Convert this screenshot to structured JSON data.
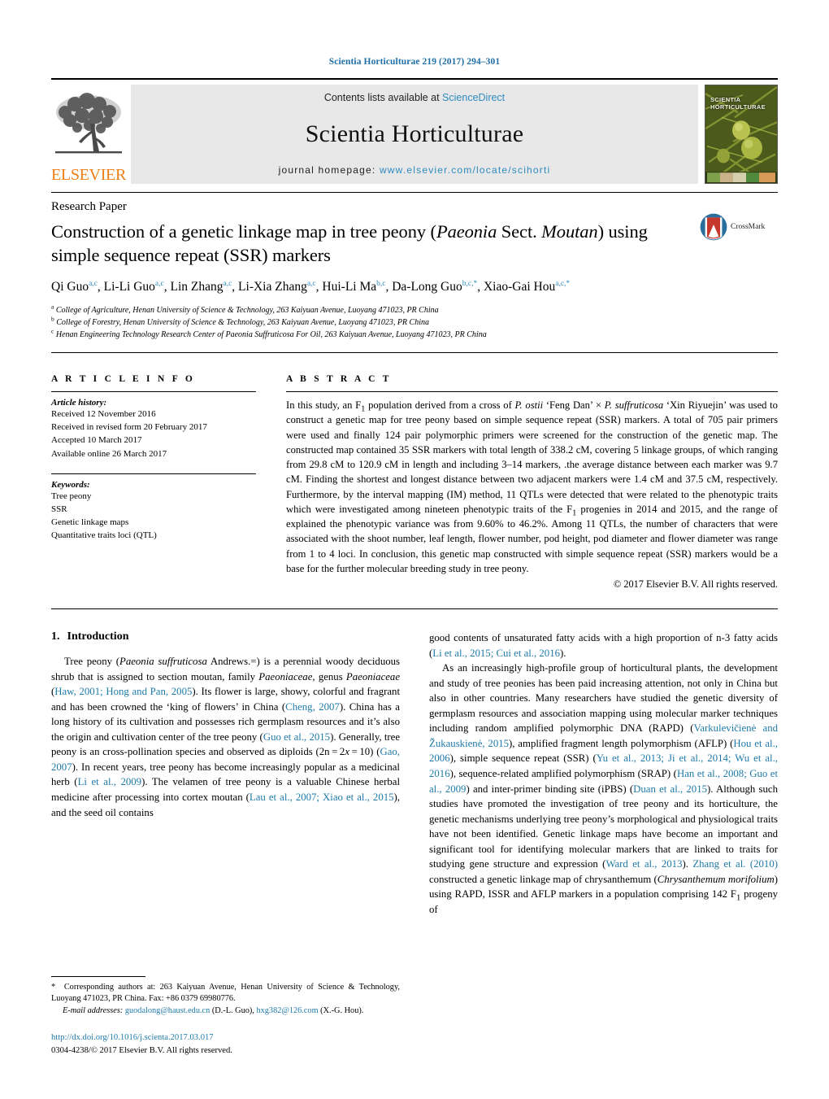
{
  "running_head": "Scientia Horticulturae 219 (2017) 294–301",
  "masthead": {
    "contents_prefix": "Contents lists available at ",
    "sciencedirect": "ScienceDirect",
    "journal_name": "Scientia Horticulturae",
    "homepage_prefix": "journal homepage: ",
    "homepage_url": "www.elsevier.com/locate/scihorti",
    "publisher_wordmark": "ELSEVIER",
    "cover_title_line1": "SCIENTIA",
    "cover_title_line2": "HORTICULTURAE",
    "link_color": "#2e8bc0",
    "elsevier_orange": "#f07f13"
  },
  "article": {
    "type": "Research Paper",
    "title_part1": "Construction of a genetic linkage map in tree peony (",
    "title_italic1": "Paeonia",
    "title_part2": " Sect. ",
    "title_italic2": "Moutan",
    "title_part3": ") using simple sequence repeat (SSR) markers",
    "authors_html": "Qi Guo<sup>a,c</sup>, Li-Li Guo<sup>a,c</sup>, Lin Zhang<sup>a,c</sup>, Li-Xia Zhang<sup>a,c</sup>, Hui-Li Ma<sup>b,c</sup>, Da-Long Guo<sup>b,c,*</sup>, Xiao-Gai Hou<sup>a,c,*</sup>",
    "crossmark_label": "CrossMark",
    "affiliations": [
      "College of Agriculture, Henan University of Science & Technology, 263 Kaiyuan Avenue, Luoyang 471023, PR China",
      "College of Forestry, Henan University of Science & Technology, 263 Kaiyuan Avenue, Luoyang 471023, PR China",
      "Henan Engineering Technology Research Center of Paeonia Suffruticosa For Oil, 263 Kaiyuan Avenue, Luoyang 471023, PR China"
    ],
    "affiliation_marks": [
      "a",
      "b",
      "c"
    ]
  },
  "article_info": {
    "heading": "A R T I C L E   I N F O",
    "history_label": "Article history:",
    "history": [
      "Received 12 November 2016",
      "Received in revised form 20 February 2017",
      "Accepted 10 March 2017",
      "Available online 26 March 2017"
    ],
    "keywords_label": "Keywords:",
    "keywords": [
      "Tree peony",
      "SSR",
      "Genetic linkage maps",
      "Quantitative traits loci (QTL)"
    ]
  },
  "abstract": {
    "heading": "A B S T R A C T",
    "body_html": "In this study, an F<sub>1</sub> population derived from a cross of <i>P. ostii</i> ‘Feng Dan’ × <i>P. suffruticosa</i> ‘Xin Riyuejin’ was used to construct a genetic map for tree peony based on simple sequence repeat (SSR) markers. A total of 705 pair primers were used and finally 124 pair polymorphic primers were screened for the construction of the genetic map. The constructed map contained 35 SSR markers with total length of 338.2 cM, covering 5 linkage groups, of which ranging from 29.8 cM to 120.9 cM in length and including 3–14 markers, .the average distance between each marker was 9.7 cM. Finding the shortest and longest distance between two adjacent markers were 1.4 cM and 37.5 cM, respectively. Furthermore, by the interval mapping (IM) method, 11 QTLs were detected that were related to the phenotypic traits which were investigated among nineteen phenotypic traits of the F<sub>1</sub> progenies in 2014 and 2015, and the range of explained the phenotypic variance was from 9.60% to 46.2%. Among 11 QTLs, the number of characters that were associated with the shoot number, leaf length, flower number, pod height, pod diameter and flower diameter was range from 1 to 4 loci. In conclusion, this genetic map constructed with simple sequence repeat (SSR) markers would be a base for the further molecular breeding study in tree peony.",
    "copyright": "© 2017 Elsevier B.V. All rights reserved."
  },
  "introduction": {
    "number": "1.",
    "heading": "Introduction",
    "left_paragraph_html": "Tree peony (<i>Paeonia suffruticosa</i> Andrews.=) is a perennial woody deciduous shrub that is assigned to section moutan, family <i>Paeoniaceae</i>, genus <i>Paeoniaceae</i> (<span class=\"ref\">Haw, 2001; Hong and Pan, 2005</span>). Its flower is large, showy, colorful and fragrant and has been crowned the ‘king of flowers’ in China (<span class=\"ref\">Cheng, 2007</span>). China has a long history of its cultivation and possesses rich germplasm resources and it’s also the origin and cultivation center of the tree peony (<span class=\"ref\">Guo et al., 2015</span>). Generally, tree peony is an cross-pollination species and observed as diploids (2n&#8201;=&#8201;2<i>x</i>&#8201;=&#8201;10) (<span class=\"ref\">Gao, 2007</span>). In recent years, tree peony has become increasingly popular as a medicinal herb (<span class=\"ref\">Li et al., 2009</span>). The velamen of tree peony is a valuable Chinese herbal medicine after processing into cortex moutan (<span class=\"ref\">Lau et al., 2007; Xiao et al., 2015</span>), and the seed oil contains",
    "right_paragraph1_html": "good contents of unsaturated fatty acids with a high proportion of n-3 fatty acids (<span class=\"ref\">Li et al., 2015; Cui et al., 2016</span>).",
    "right_paragraph2_html": "As an increasingly high-profile group of horticultural plants, the development and study of tree peonies has been paid increasing attention, not only in China but also in other countries. Many researchers have studied the genetic diversity of germplasm resources and association mapping using molecular marker techniques including random amplified polymorphic DNA (RAPD) (<span class=\"ref\">Varkulevičienė and Žukauskienė, 2015</span>), amplified fragment length polymorphism (AFLP) (<span class=\"ref\">Hou et al., 2006</span>), simple sequence repeat (SSR) (<span class=\"ref\">Yu et al., 2013; Ji et al., 2014; Wu et al., 2016</span>), sequence-related amplified polymorphism (SRAP) (<span class=\"ref\">Han et al., 2008; Guo et al., 2009</span>) and inter-primer binding site (iPBS) (<span class=\"ref\">Duan et al., 2015</span>). Although such studies have promoted the investigation of tree peony and its horticulture, the genetic mechanisms underlying tree peony’s morphological and physiological traits have not been identified. Genetic linkage maps have become an important and significant tool for identifying molecular markers that are linked to traits for studying gene structure and expression (<span class=\"ref\">Ward et al., 2013</span>). <span class=\"ref\">Zhang et al. (2010)</span> constructed a genetic linkage map of chrysanthemum (<i>Chrysanthemum morifolium</i>) using RAPD, ISSR and AFLP markers in a population comprising 142 F<sub>1</sub> progeny of"
  },
  "footnote": {
    "corresponding_html": "<span class=\"star\">*</span>&nbsp; Corresponding authors at: 263 Kaiyuan Avenue, Henan University of Science & Technology, Luoyang 471023, PR China. Fax: +86 0379 69980776.",
    "email_html": "<i>E-mail addresses:</i> <span class=\"ref\">guodalong@haust.edu.cn</span> (D.-L. Guo), <span class=\"ref\">hxg382@126.com</span> (X.-G. Hou).",
    "doi": "http://dx.doi.org/10.1016/j.scienta.2017.03.017",
    "issn_line": "0304-4238/© 2017 Elsevier B.V. All rights reserved."
  }
}
